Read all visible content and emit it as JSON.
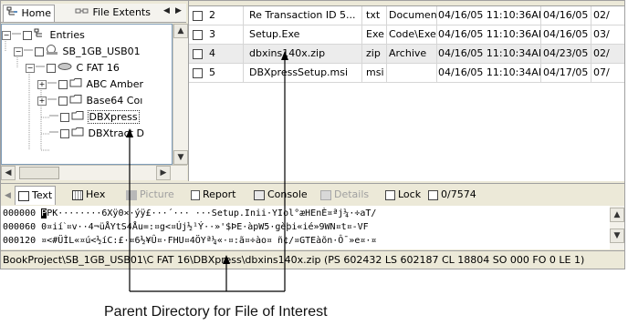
{
  "left_tabs": {
    "home": "Home",
    "file_extents": "File Extents"
  },
  "tree": [
    {
      "label": "Entries",
      "icon": "entries-icon"
    },
    {
      "label": "SB_1GB_USB01",
      "icon": "drive-icon"
    },
    {
      "label": "C FAT 16",
      "icon": "volume-icon"
    },
    {
      "label": "ABC Amber",
      "icon": "folder-icon"
    },
    {
      "label": "Base64 Coı",
      "icon": "folder-icon"
    },
    {
      "label": "DBXpress",
      "icon": "folder-icon",
      "selected": true
    },
    {
      "label": "DBXtract D",
      "icon": "folder-icon"
    }
  ],
  "grid": {
    "rows": [
      {
        "num": "2",
        "name": "Re Transaction ID 5...",
        "ext": "txt",
        "category": "Documenl",
        "written": "04/16/05 11:10:36AM",
        "accessed": "04/16/05",
        "created": "02/"
      },
      {
        "num": "3",
        "name": "Setup.Exe",
        "ext": "Exe",
        "category": "Code\\Exe",
        "written": "04/16/05 11:10:36AM",
        "accessed": "04/16/05",
        "created": "03/"
      },
      {
        "num": "4",
        "name": "dbxins140x.zip",
        "ext": "zip",
        "category": "Archive",
        "written": "04/16/05 11:10:34AM",
        "accessed": "04/23/05",
        "created": "02/"
      },
      {
        "num": "5",
        "name": "DBXpressSetup.msi",
        "ext": "msi",
        "category": "",
        "written": "04/16/05 11:10:34AM",
        "accessed": "04/17/05",
        "created": "07/"
      }
    ]
  },
  "bottom_tabs": {
    "text": "Text",
    "hex": "Hex",
    "picture": "Picture",
    "report": "Report",
    "console": "Console",
    "details": "Details",
    "lock": "Lock",
    "count": "0/7574"
  },
  "hex_lines": [
    {
      "offset": "000000",
      "content": "PK········6Xÿ0×·ýÿ£···´··· ···Setup.Inii·YIol°æHEnÈ¤ªj¼·÷aT/"
    },
    {
      "offset": "000060",
      "content": "0¤iíˋ¤v··4¬üÅYtS4Åu=:¤g<¤Új½¹Ý··»'$ÞE·àpW5·gèþi«ié»9WN¤t¤-VF"
    },
    {
      "offset": "000120",
      "content": "¤<#ÜÌL«¤ú<½íC:£·¤6½¥Û¤·FHU¤4ÖYª¼«·¤:ã¤÷ào¤ ñ¢/¤GTEàõn·Ô¯»e¤·¤"
    }
  ],
  "status_path": "BookProject\\SB_1GB_USB01\\C FAT 16\\DBXpress\\dbxins140x.zip (PS 602432  LS 602187  CL 18804  SO 000  FO 0  LE 1)",
  "caption": "Parent Directory for File of Interest",
  "colors": {
    "panel": "#ece9d8",
    "selection": "#ececec",
    "border": "#a0a0a0",
    "callout": "#000000"
  }
}
